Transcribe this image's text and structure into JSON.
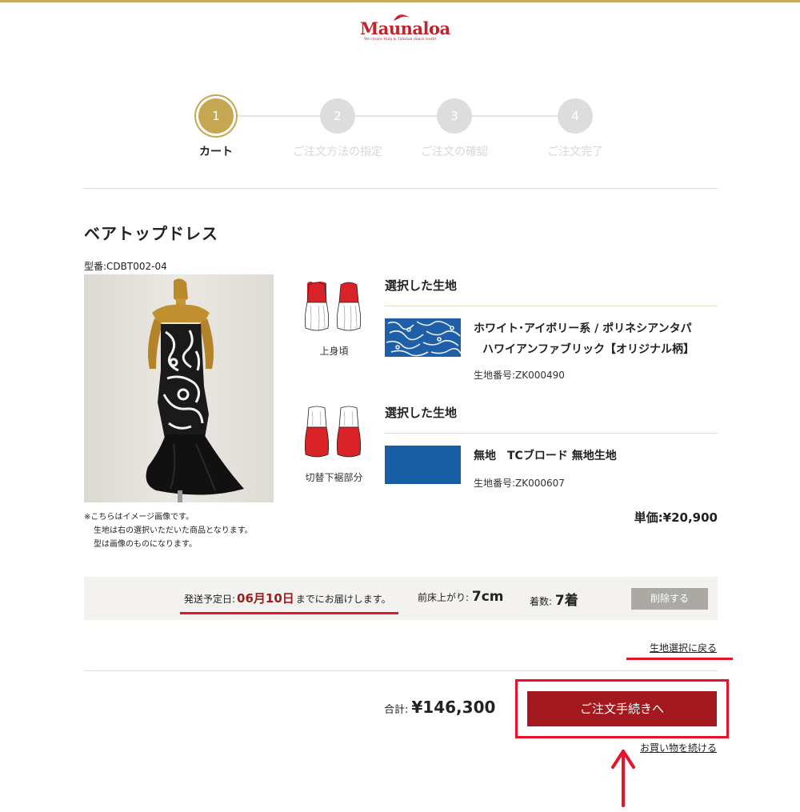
{
  "header": {
    "logo_text": "Maunaloa",
    "logo_tagline": "We create Hula & Tahitian dance world",
    "accent_gold": "#c7aa5e",
    "brand_red": "#c4222a"
  },
  "steps": [
    {
      "number": "1",
      "label": "カート",
      "active": true
    },
    {
      "number": "2",
      "label": "ご注文方法の指定",
      "active": false
    },
    {
      "number": "3",
      "label": "ご注文の確認",
      "active": false
    },
    {
      "number": "4",
      "label": "ご注文完了",
      "active": false
    }
  ],
  "product": {
    "name": "ベアトップドレス",
    "model": "型番:CDBT002-04",
    "notes": [
      "※こちらはイメージ画像です。",
      "生地は右の選択いただいた商品となります。",
      "型は画像のものになります。"
    ]
  },
  "parts": [
    {
      "label": "上身頃",
      "fabric_title": "選択した生地",
      "fabric_name_line1": "ホワイト･アイボリー系 / ポリネシアンタパ",
      "fabric_name_line2": "ハワイアンファブリック【オリジナル柄】",
      "fabric_no": "生地番号:ZK000490",
      "swatch_color": "#1f5fa8"
    },
    {
      "label": "切替下裾部分",
      "fabric_title": "選択した生地",
      "fabric_name_line1": "無地　TCブロード 無地生地",
      "fabric_no": "生地番号:ZK000607",
      "swatch_color": "#175ea4"
    }
  ],
  "price": "単価:¥20,900",
  "shipping": {
    "prefix": "発送予定日:",
    "date": "06月10日",
    "suffix": "までにお届けします。"
  },
  "finish": {
    "label": "前床上がり:",
    "value": "7cm"
  },
  "quantity": {
    "label": "着数:",
    "value": "7着"
  },
  "delete_label": "削除する",
  "back_link": "生地選択に戻る",
  "total": {
    "label": "合計:",
    "amount": "¥146,300"
  },
  "order_button": "ご注文手続きへ",
  "continue_link": "お買い物を続ける"
}
